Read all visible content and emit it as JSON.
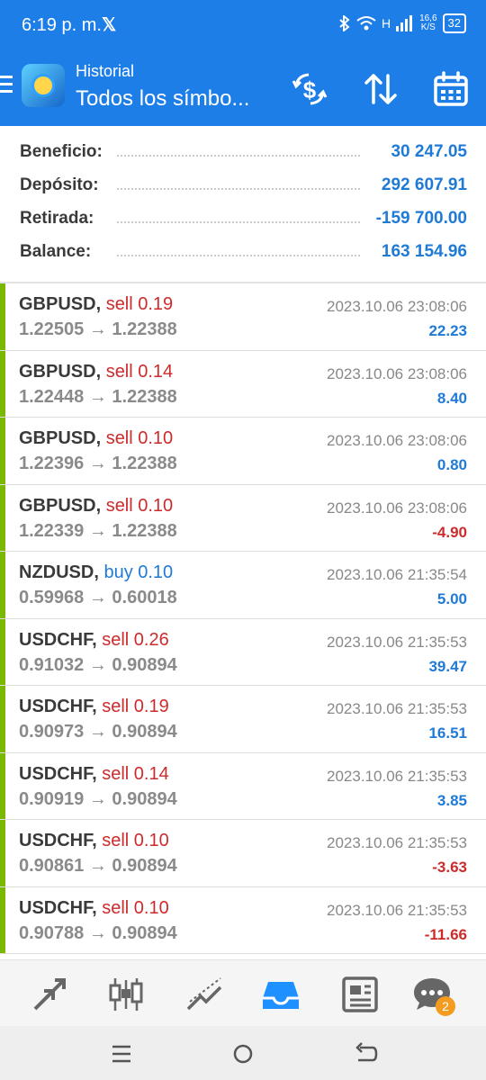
{
  "status_bar": {
    "time": "6:19 p. m.",
    "x_logo": "𝕏",
    "signal": "H",
    "net_speed": "16,6",
    "net_unit": "K/S",
    "battery": "32"
  },
  "header": {
    "subtitle": "Historial",
    "title": "Todos los símbo..."
  },
  "summary": [
    {
      "label": "Beneficio:",
      "value": "30 247.05"
    },
    {
      "label": "Depósito:",
      "value": "292 607.91"
    },
    {
      "label": "Retirada:",
      "value": "-159 700.00"
    },
    {
      "label": "Balance:",
      "value": "163 154.96"
    }
  ],
  "trades": [
    {
      "symbol": "GBPUSD,",
      "action": "sell 0.19",
      "side": "sell",
      "open": "1.22505",
      "close": "1.22388",
      "time": "2023.10.06 23:08:06",
      "profit": "22.23",
      "neg": false
    },
    {
      "symbol": "GBPUSD,",
      "action": "sell 0.14",
      "side": "sell",
      "open": "1.22448",
      "close": "1.22388",
      "time": "2023.10.06 23:08:06",
      "profit": "8.40",
      "neg": false
    },
    {
      "symbol": "GBPUSD,",
      "action": "sell 0.10",
      "side": "sell",
      "open": "1.22396",
      "close": "1.22388",
      "time": "2023.10.06 23:08:06",
      "profit": "0.80",
      "neg": false
    },
    {
      "symbol": "GBPUSD,",
      "action": "sell 0.10",
      "side": "sell",
      "open": "1.22339",
      "close": "1.22388",
      "time": "2023.10.06 23:08:06",
      "profit": "-4.90",
      "neg": true
    },
    {
      "symbol": "NZDUSD,",
      "action": "buy 0.10",
      "side": "buy",
      "open": "0.59968",
      "close": "0.60018",
      "time": "2023.10.06 21:35:54",
      "profit": "5.00",
      "neg": false
    },
    {
      "symbol": "USDCHF,",
      "action": "sell 0.26",
      "side": "sell",
      "open": "0.91032",
      "close": "0.90894",
      "time": "2023.10.06 21:35:53",
      "profit": "39.47",
      "neg": false
    },
    {
      "symbol": "USDCHF,",
      "action": "sell 0.19",
      "side": "sell",
      "open": "0.90973",
      "close": "0.90894",
      "time": "2023.10.06 21:35:53",
      "profit": "16.51",
      "neg": false
    },
    {
      "symbol": "USDCHF,",
      "action": "sell 0.14",
      "side": "sell",
      "open": "0.90919",
      "close": "0.90894",
      "time": "2023.10.06 21:35:53",
      "profit": "3.85",
      "neg": false
    },
    {
      "symbol": "USDCHF,",
      "action": "sell 0.10",
      "side": "sell",
      "open": "0.90861",
      "close": "0.90894",
      "time": "2023.10.06 21:35:53",
      "profit": "-3.63",
      "neg": true
    },
    {
      "symbol": "USDCHF,",
      "action": "sell 0.10",
      "side": "sell",
      "open": "0.90788",
      "close": "0.90894",
      "time": "2023.10.06 21:35:53",
      "profit": "-11.66",
      "neg": true
    }
  ],
  "arrow_glyph": "→",
  "tabs": [
    {
      "name": "quotes",
      "icon": "arrows-diagonal-icon"
    },
    {
      "name": "chart",
      "icon": "candlestick-icon"
    },
    {
      "name": "trade",
      "icon": "trend-line-icon"
    },
    {
      "name": "history",
      "icon": "inbox-icon",
      "active": true
    },
    {
      "name": "news",
      "icon": "newspaper-icon"
    },
    {
      "name": "chat",
      "icon": "chat-bubble-icon",
      "badge": "2"
    }
  ],
  "colors": {
    "accent": "#1e7ee8",
    "sell": "#cc2b2b",
    "buy": "#1f7ad6",
    "row_bar": "#7ab800",
    "badge": "#f39c1f"
  }
}
